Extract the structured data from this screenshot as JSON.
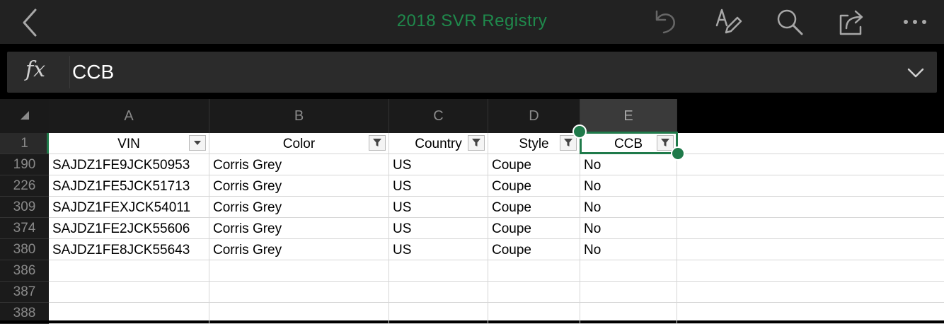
{
  "topbar": {
    "title": "2018 SVR Registry",
    "icons": [
      "back-chevron-icon",
      "undo-icon",
      "draw-icon",
      "search-icon",
      "share-icon",
      "more-icon"
    ]
  },
  "formula_bar": {
    "fx_label": "fx",
    "content": "CCB",
    "expand_icon": "chevron-down-icon"
  },
  "columns": [
    "A",
    "B",
    "C",
    "D",
    "E"
  ],
  "selected_column": "E",
  "row_numbers": [
    "1",
    "190",
    "226",
    "309",
    "374",
    "380",
    "386",
    "387",
    "388"
  ],
  "header_row": {
    "A": "VIN",
    "B": "Color",
    "C": "Country",
    "D": "Style",
    "E": "CCB"
  },
  "filter_states": {
    "A": "dropdown",
    "B": "filtered",
    "C": "filtered",
    "D": "filtered",
    "E": "filtered"
  },
  "rows": [
    {
      "A": "SAJDZ1FE9JCK50953",
      "B": "Corris Grey",
      "C": "US",
      "D": "Coupe",
      "E": "No"
    },
    {
      "A": "SAJDZ1FE5JCK51713",
      "B": "Corris Grey",
      "C": "US",
      "D": "Coupe",
      "E": "No"
    },
    {
      "A": "SAJDZ1FEXJCK54011",
      "B": "Corris Grey",
      "C": "US",
      "D": "Coupe",
      "E": "No"
    },
    {
      "A": "SAJDZ1FE2JCK55606",
      "B": "Corris Grey",
      "C": "US",
      "D": "Coupe",
      "E": "No"
    },
    {
      "A": "SAJDZ1FE8JCK55643",
      "B": "Corris Grey",
      "C": "US",
      "D": "Coupe",
      "E": "No"
    },
    {
      "A": "",
      "B": "",
      "C": "",
      "D": "",
      "E": ""
    },
    {
      "A": "",
      "B": "",
      "C": "",
      "D": "",
      "E": ""
    },
    {
      "A": "",
      "B": "",
      "C": "",
      "D": "",
      "E": ""
    }
  ],
  "colors": {
    "accent": "#1f7a4a",
    "title": "#1f8a4c",
    "toolbar_bg": "#222222"
  }
}
